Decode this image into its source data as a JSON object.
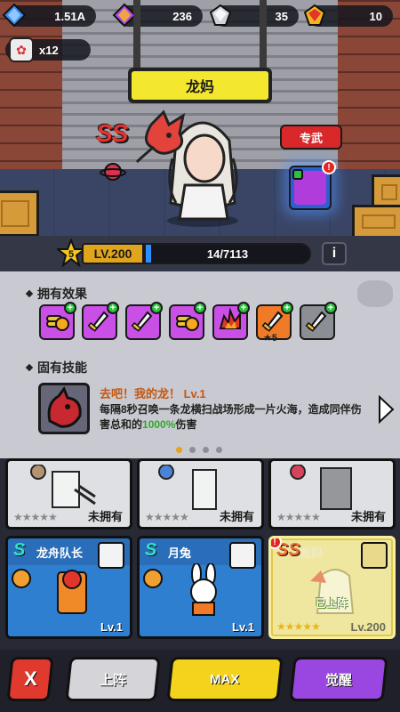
{
  "resources": [
    {
      "id": "blue-gem",
      "value": "1.51A",
      "color": "#3a8cf0"
    },
    {
      "id": "purple-gem",
      "value": "236",
      "color": "#a84fe6"
    },
    {
      "id": "silver-gem",
      "value": "35",
      "color": "#cfd3dc"
    },
    {
      "id": "gold-gem",
      "value": "10",
      "color": "#f2b61c"
    }
  ],
  "ticket": {
    "count": "x12"
  },
  "hero": {
    "name": "龙妈",
    "rank": "SS",
    "weapon_tag": "专武",
    "level_text": "LV.200",
    "stars": "5",
    "exp_text": "14/7113",
    "exp_ratio": 0.002,
    "info_label": "i"
  },
  "effects": {
    "title": "拥有效果",
    "items": [
      {
        "icon": "gold-coin-icon",
        "color": "#c94fe6",
        "count": ""
      },
      {
        "icon": "sword-icon",
        "color": "#c94fe6",
        "count": ""
      },
      {
        "icon": "sword-icon",
        "color": "#c94fe6",
        "count": ""
      },
      {
        "icon": "gold-coin-icon",
        "color": "#c94fe6",
        "count": ""
      },
      {
        "icon": "fire-icon",
        "color": "#c94fe6",
        "count": ""
      },
      {
        "icon": "sword-icon",
        "color": "#f07a28",
        "count": "5"
      },
      {
        "icon": "sword-icon",
        "color": "#8c8e96",
        "count": ""
      }
    ]
  },
  "skill": {
    "title": "固有技能",
    "name": "去吧！我的龙！ Lv.1",
    "desc_prefix": "每隔8秒召唤一条龙横扫战场形成一片火海，造成同伴伤害总和的",
    "desc_highlight": "1000%",
    "desc_suffix": "伤害"
  },
  "pager": {
    "total": 4,
    "active": 0
  },
  "cards": [
    {
      "name": "",
      "owned_label": "未拥有",
      "stars": "★★★★★"
    },
    {
      "name": "",
      "owned_label": "未拥有",
      "stars": "★★★★★"
    },
    {
      "name": "",
      "owned_label": "未拥有",
      "stars": "★★★★★"
    },
    {
      "rank": "S",
      "name": "龙舟队长",
      "level": "Lv.1",
      "stars": ""
    },
    {
      "rank": "S",
      "name": "月兔",
      "level": "Lv.1",
      "stars": ""
    },
    {
      "rank": "SS",
      "name": "龙妈",
      "level": "Lv.200",
      "stars": "★★★★★",
      "status": "已上阵"
    }
  ],
  "buttons": {
    "close": "X",
    "deploy": "上阵",
    "max": "MAX",
    "awaken": "觉醒"
  }
}
